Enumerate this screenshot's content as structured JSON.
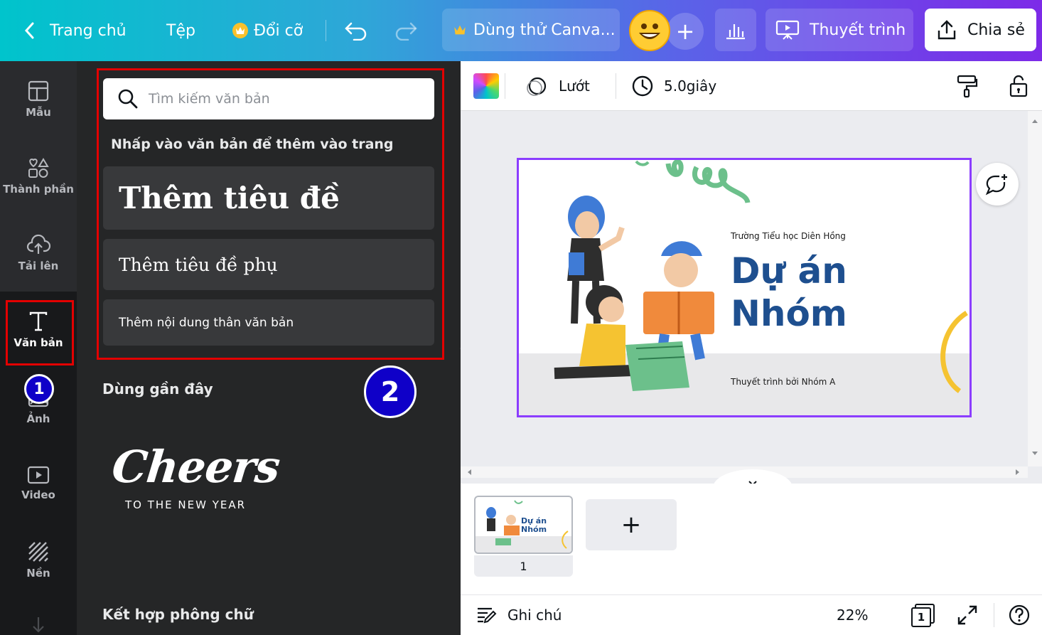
{
  "topbar": {
    "home_label": "Trang chủ",
    "file_label": "Tệp",
    "resize_label": "Đổi cỡ",
    "trial_label": "Dùng thử Canva...",
    "present_label": "Thuyết trình",
    "share_label": "Chia sẻ"
  },
  "rail": {
    "items": [
      {
        "label": "Mẫu",
        "icon": "template-icon"
      },
      {
        "label": "Thành phần",
        "icon": "elements-icon"
      },
      {
        "label": "Tải lên",
        "icon": "upload-cloud-icon"
      },
      {
        "label": "Văn bản",
        "icon": "text-icon"
      },
      {
        "label": "Ảnh",
        "icon": "photo-icon"
      },
      {
        "label": "Video",
        "icon": "video-icon"
      },
      {
        "label": "Nền",
        "icon": "background-icon"
      }
    ],
    "badge_1": "1"
  },
  "panel": {
    "search_placeholder": "Tìm kiếm văn bản",
    "hint": "Nhấp vào văn bản để thêm vào trang",
    "heading_card": "Thêm tiêu đề",
    "subheading_card": "Thêm tiêu đề phụ",
    "body_card": "Thêm nội dung thân văn bản",
    "recent_title": "Dùng gần đây",
    "badge_2": "2",
    "cheers_main": "Cheers",
    "cheers_sub": "TO THE NEW YEAR",
    "font_combo_title": "Kết hợp phông chữ"
  },
  "editor_toolbar": {
    "transition_label": "Lướt",
    "duration_label": "5.0giây"
  },
  "slide": {
    "school": "Trường Tiểu học Diên Hồng",
    "title_line1": "Dự án",
    "title_line2": "Nhóm",
    "byline": "Thuyết trình bởi Nhóm A"
  },
  "pages": {
    "page_number": "1",
    "thumb_title1": "Dự án",
    "thumb_title2": "Nhóm"
  },
  "footer": {
    "notes_label": "Ghi chú",
    "zoom": "22%",
    "page_count": "1"
  },
  "colors": {
    "accent": "#8b3dff",
    "highlight": "#e30000",
    "badge": "#0f00c8",
    "slide_title": "#1e4f8f"
  }
}
